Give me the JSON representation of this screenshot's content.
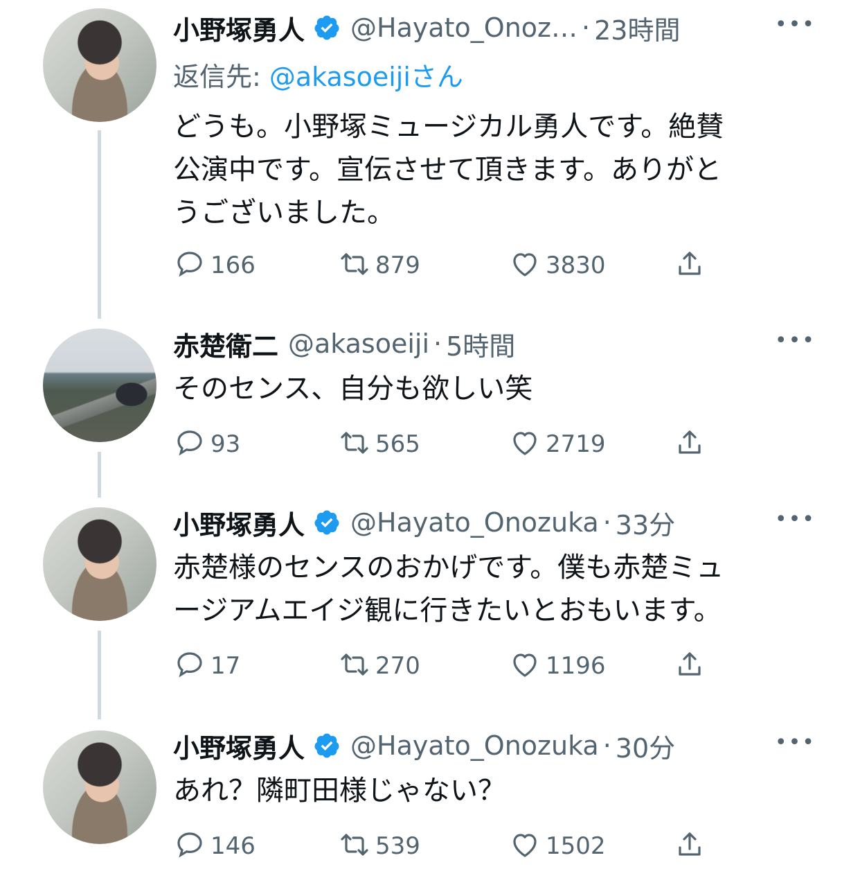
{
  "tweets": [
    {
      "name": "小野塚勇人",
      "verified": true,
      "handle": "@Hayato_Onoz…",
      "sep": "·",
      "time": "23時間",
      "reply_prefix": "返信先: ",
      "reply_handle": "@akasoeijiさん",
      "lines": [
        "どうも。小野塚ミュージカル勇人です。絶賛",
        "公演中です。宣伝させて頂きます。ありがと",
        "うございました。"
      ],
      "replies": "166",
      "retweets": "879",
      "likes": "3830"
    },
    {
      "name": "赤楚衛二",
      "verified": false,
      "handle": "@akasoeiji",
      "sep": "·",
      "time": "5時間",
      "lines": [
        "そのセンス、自分も欲しい笑"
      ],
      "replies": "93",
      "retweets": "565",
      "likes": "2719"
    },
    {
      "name": "小野塚勇人",
      "verified": true,
      "handle": "@Hayato_Onozuka",
      "sep": "·",
      "time": "33分",
      "lines": [
        "赤楚様のセンスのおかげです。僕も赤楚ミュ",
        "ージアムエイジ観に行きたいとおもいます。"
      ],
      "replies": "17",
      "retweets": "270",
      "likes": "1196"
    },
    {
      "name": "小野塚勇人",
      "verified": true,
      "handle": "@Hayato_Onozuka",
      "sep": "·",
      "time": "30分",
      "lines": [
        "あれ？隣町田様じゃない？"
      ],
      "replies": "146",
      "retweets": "539",
      "likes": "1502"
    }
  ],
  "icons": {
    "verified": "verified-badge-icon",
    "more": "more-options-icon",
    "reply": "reply-bubble-icon",
    "retweet": "retweet-icon",
    "like": "heart-icon",
    "share": "share-upload-icon"
  },
  "more_glyph": "•••",
  "colors": {
    "accent": "#1d9bf0",
    "muted": "#536471",
    "text": "#0f1419",
    "thread": "#cfd9de"
  }
}
